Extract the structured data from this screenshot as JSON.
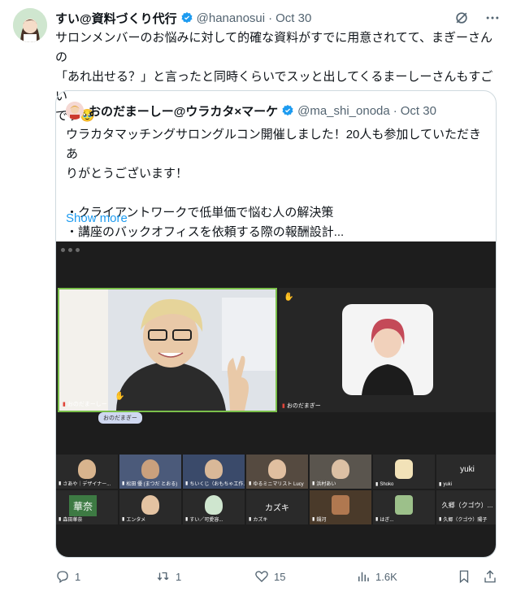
{
  "tweet": {
    "author_name": "すい@資料づくり代行",
    "handle": "@hananosui",
    "date": "Oct 30",
    "text_lines": [
      "サロンメンバーのお悩みに対して的確な資料がすでに用意されてて、まぎーさんの",
      "「あれ出せる？」と言ったと同時くらいでスッと出してくるまーしーさんもすごい",
      "です"
    ],
    "emoji": "🥹"
  },
  "quote": {
    "author_name": "おのだまーしー@ウラカタ×マーケ",
    "handle": "@ma_shi_onoda",
    "date": "Oct 30",
    "text_lines": [
      "ウラカタマッチングサロングルコン開催しました！20人も参加していただきあ",
      "りがとうございます！",
      "",
      "・クライアントワークで低単価で悩む人の解決策",
      "・講座のバックオフィスを依頼する際の報酬設計..."
    ],
    "show_more": "Show more"
  },
  "video": {
    "main_label": "おのだまーしー",
    "main_tip": "おのだまぎー",
    "second_label": "おのだまぎー",
    "row1": [
      {
        "name": "さあや｜デザイナー..."
      },
      {
        "name": "松田 優 (まつだ とおる)"
      },
      {
        "name": "ちいくじ（おもちゃ工作..."
      },
      {
        "name": "ゆるミニマリスト Lucy"
      },
      {
        "name": "浜村あい"
      },
      {
        "name": "Shoko"
      },
      {
        "name": "yuki",
        "big": "yuki"
      }
    ],
    "row2": [
      {
        "name": "森田華奈",
        "big": "華奈"
      },
      {
        "name": "エンタメ"
      },
      {
        "name": "すい／可愛容..."
      },
      {
        "name": "カズキ",
        "big": "カズキ"
      },
      {
        "name": "鍋河"
      },
      {
        "name": "はぎ..."
      },
      {
        "name": "久郷（クゴウ）陽子",
        "big": "久郷（クゴウ）..."
      }
    ]
  },
  "actions": {
    "reply": "1",
    "retweet": "1",
    "like": "15",
    "views": "1.6K"
  },
  "colors": {
    "accent": "#1d9bf0",
    "muted": "#536471",
    "verified": "#1d9bf0",
    "active_speaker": "#7bc04b"
  }
}
